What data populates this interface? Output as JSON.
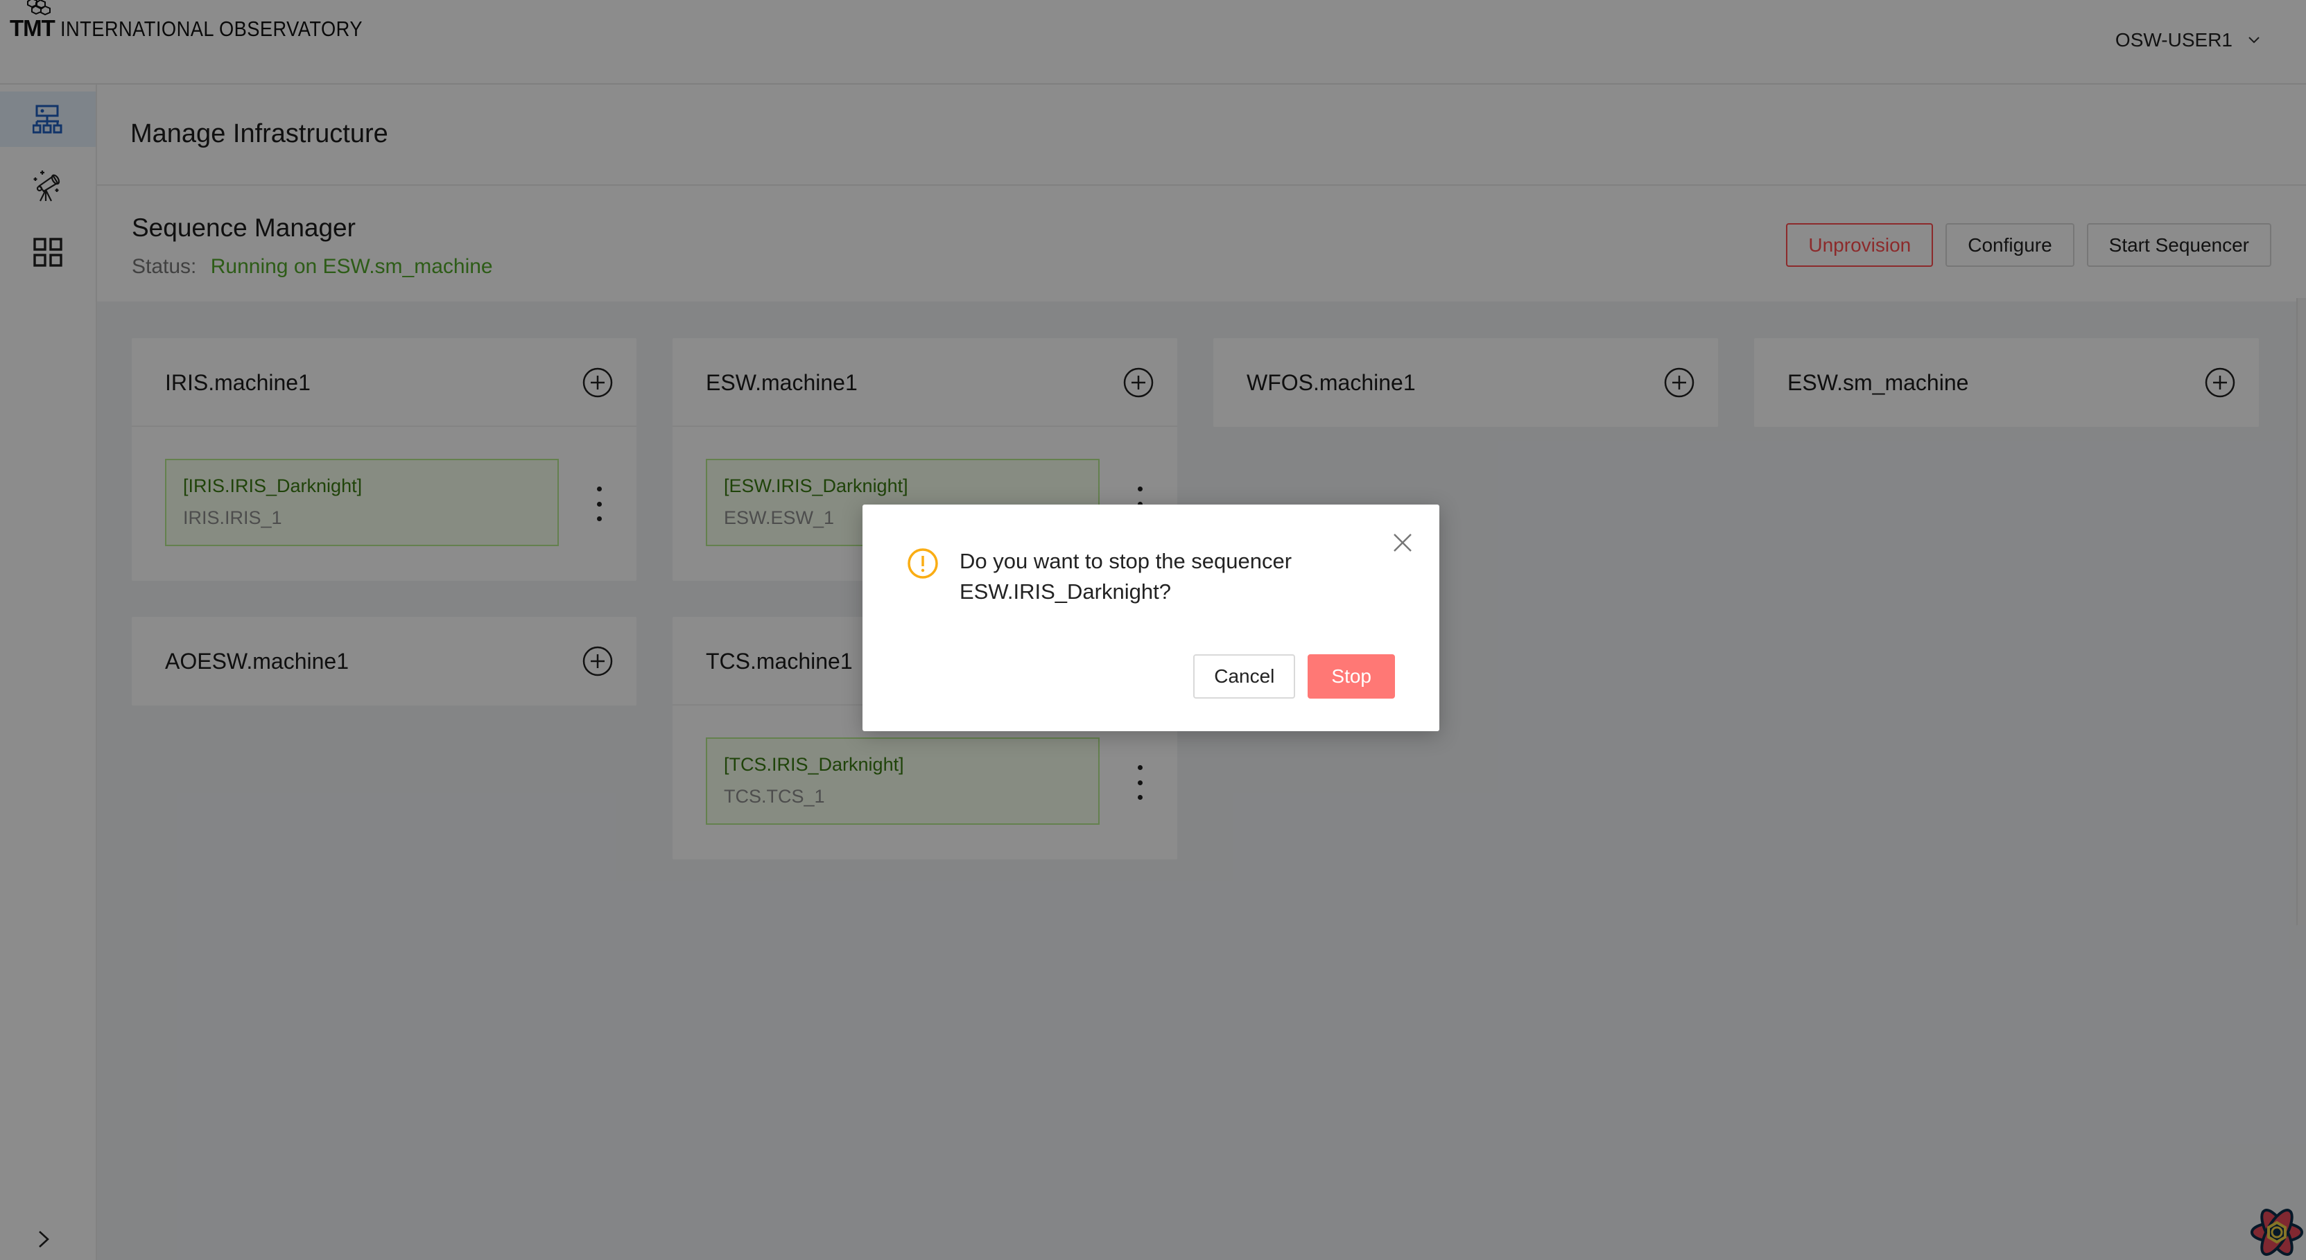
{
  "header": {
    "logo_mark": "TMT",
    "logo_text": "INTERNATIONAL OBSERVATORY",
    "user_name": "OSW-USER1",
    "user_menu_icon": "chevron-down-icon"
  },
  "sidebar": {
    "items": [
      {
        "icon": "sitemap-icon",
        "active": true
      },
      {
        "icon": "telescope-icon",
        "active": false
      },
      {
        "icon": "grid-icon",
        "active": false
      }
    ],
    "collapse_icon": "chevron-right-icon"
  },
  "page": {
    "title": "Manage Infrastructure"
  },
  "sequence_manager": {
    "title": "Sequence Manager",
    "status_label": "Status:",
    "status_value": "Running on ESW.sm_machine",
    "buttons": {
      "unprovision": "Unprovision",
      "configure": "Configure",
      "start_sequencer": "Start Sequencer"
    }
  },
  "machines": [
    {
      "name": "IRIS.machine1",
      "sequencers": [
        {
          "name": "[IRIS.IRIS_Darknight]",
          "id": "IRIS.IRIS_1"
        }
      ]
    },
    {
      "name": "ESW.machine1",
      "sequencers": [
        {
          "name": "[ESW.IRIS_Darknight]",
          "id": "ESW.ESW_1"
        }
      ]
    },
    {
      "name": "WFOS.machine1",
      "sequencers": []
    },
    {
      "name": "ESW.sm_machine",
      "sequencers": []
    },
    {
      "name": "AOESW.machine1",
      "sequencers": []
    },
    {
      "name": "TCS.machine1",
      "sequencers": [
        {
          "name": "[TCS.IRIS_Darknight]",
          "id": "TCS.TCS_1"
        }
      ]
    }
  ],
  "dialog": {
    "icon": "exclamation-circle-icon",
    "message_line1": "Do you want to stop the sequencer",
    "message_line2": "ESW.IRIS_Darknight?",
    "cancel_label": "Cancel",
    "confirm_label": "Stop"
  },
  "colors": {
    "accent": "#1f5fbf",
    "status_running": "#52a82a",
    "danger": "#ff4d4f",
    "stop_button": "#ff7875",
    "warning": "#faad14",
    "sequencer_bg": "#f6ffed",
    "sequencer_border": "#b7eb8f"
  }
}
